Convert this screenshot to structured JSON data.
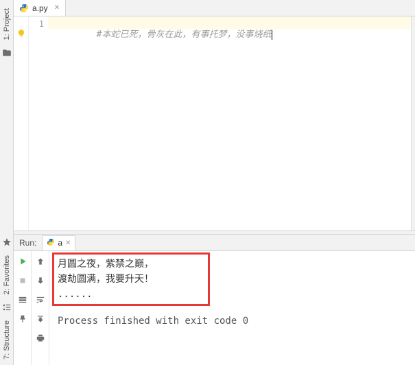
{
  "left_tools": {
    "project_label": "1: Project",
    "favorites_label": "2: Favorites",
    "structure_label": "7: Structure"
  },
  "editor": {
    "tab": {
      "filename": "a.py"
    },
    "line_number": "1",
    "code_comment": "#本蛇已死，骨灰在此，有事托梦，没事烧纸"
  },
  "run": {
    "label": "Run:",
    "tab_name": "a",
    "output_lines": [
      "月圆之夜，紫禁之巅，",
      "渡劫圆满，我要升天！",
      "......"
    ],
    "exit_message": "Process finished with exit code 0"
  }
}
